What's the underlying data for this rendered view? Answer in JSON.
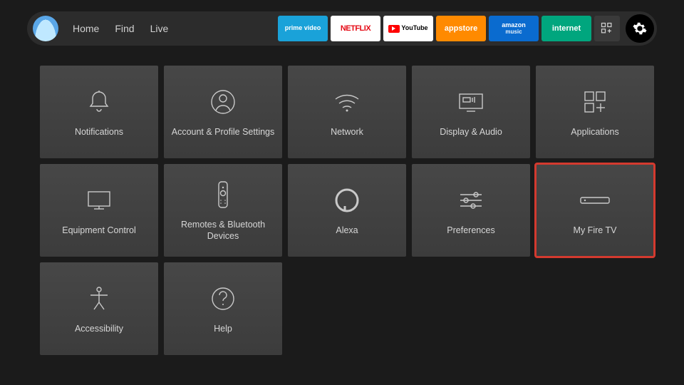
{
  "nav": {
    "home": "Home",
    "find": "Find",
    "live": "Live"
  },
  "apps": {
    "prime_line1": "prime video",
    "netflix": "NETFLIX",
    "youtube": "YouTube",
    "appstore": "appstore",
    "music_line1": "amazon",
    "music_line2": "music",
    "internet": "internet"
  },
  "tiles": {
    "notifications": "Notifications",
    "account": "Account & Profile Settings",
    "network": "Network",
    "display": "Display & Audio",
    "applications": "Applications",
    "equipment": "Equipment Control",
    "remotes": "Remotes & Bluetooth Devices",
    "alexa": "Alexa",
    "preferences": "Preferences",
    "myfiretv": "My Fire TV",
    "accessibility": "Accessibility",
    "help": "Help"
  }
}
